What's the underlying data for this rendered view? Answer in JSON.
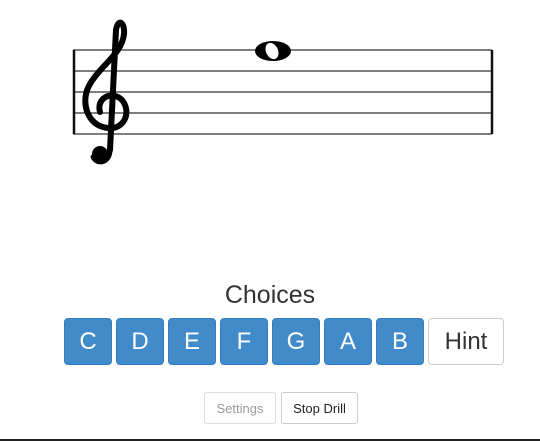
{
  "staff": {
    "clef": "treble-clef-icon",
    "note": "whole-note"
  },
  "choices": {
    "title": "Choices",
    "notes": [
      "C",
      "D",
      "E",
      "F",
      "G",
      "A",
      "B"
    ],
    "hint_label": "Hint",
    "accent_color": "#428bca"
  },
  "controls": {
    "settings_label": "Settings",
    "stop_label": "Stop Drill"
  }
}
